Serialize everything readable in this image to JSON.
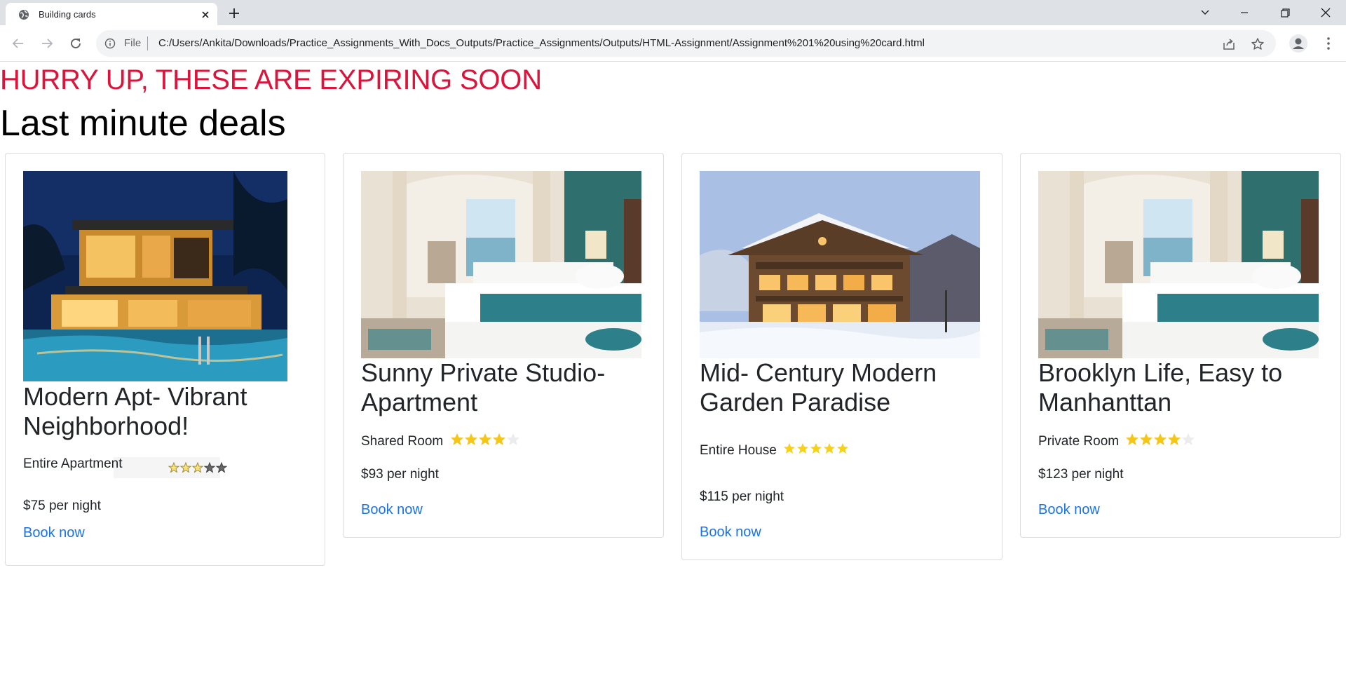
{
  "browser": {
    "tab_title": "Building cards",
    "scheme": "File",
    "url": "C:/Users/Ankita/Downloads/Practice_Assignments_With_Docs_Outputs/Practice_Assignments/Outputs/HTML-Assignment/Assignment%201%20using%20card.html"
  },
  "page": {
    "hurry": "HURRY UP, THESE ARE EXPIRING SOON",
    "heading": "Last minute deals"
  },
  "cards": [
    {
      "title": "Modern Apt- Vibrant Neighborhood!",
      "type": "Entire Apartment",
      "rating": 3,
      "price": "$75 per night",
      "link": "Book now",
      "image": "modern-house-pool-night"
    },
    {
      "title": "Sunny Private Studio-Apartment",
      "type": "Shared Room",
      "rating": 4,
      "price": "$93 per night",
      "link": "Book now",
      "image": "hotel-bedroom-teal"
    },
    {
      "title": "Mid- Century Modern Garden Paradise",
      "type": "Entire House",
      "rating": 5,
      "price": "$115 per night",
      "link": "Book now",
      "image": "snowy-chalet"
    },
    {
      "title": "Brooklyn Life, Easy to Manhanttan",
      "type": "Private Room",
      "rating": 4,
      "price": "$123 per night",
      "link": "Book now",
      "image": "hotel-bedroom-teal"
    }
  ],
  "colors": {
    "accent": "#dc143c",
    "link": "#1a73e8",
    "star": "#f5c518"
  }
}
